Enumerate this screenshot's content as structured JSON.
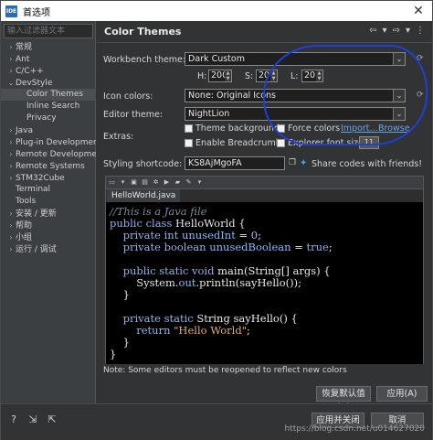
{
  "window": {
    "title": "首选项",
    "app_icon_text": "IDE",
    "close_label": "✕"
  },
  "filter": {
    "placeholder": "输入过滤器文本"
  },
  "tree": [
    {
      "label": "常规",
      "arrow": "›",
      "level": 0
    },
    {
      "label": "Ant",
      "arrow": "›",
      "level": 0
    },
    {
      "label": "C/C++",
      "arrow": "›",
      "level": 0
    },
    {
      "label": "DevStyle",
      "arrow": "⌄",
      "level": 0
    },
    {
      "label": "Color Themes",
      "arrow": "",
      "level": 1,
      "selected": true
    },
    {
      "label": "Inline Search",
      "arrow": "",
      "level": 1
    },
    {
      "label": "Privacy",
      "arrow": "",
      "level": 1
    },
    {
      "label": "Java",
      "arrow": "›",
      "level": 0
    },
    {
      "label": "Plug-in Development",
      "arrow": "›",
      "level": 0
    },
    {
      "label": "Remote Development",
      "arrow": "›",
      "level": 0
    },
    {
      "label": "Remote Systems",
      "arrow": "›",
      "level": 0
    },
    {
      "label": "STM32Cube",
      "arrow": "›",
      "level": 0
    },
    {
      "label": "Terminal",
      "arrow": "",
      "level": 0
    },
    {
      "label": "Tools",
      "arrow": "",
      "level": 0
    },
    {
      "label": "安装 / 更新",
      "arrow": "›",
      "level": 0
    },
    {
      "label": "帮助",
      "arrow": "›",
      "level": 0
    },
    {
      "label": "小组",
      "arrow": "›",
      "level": 0
    },
    {
      "label": "运行 / 调试",
      "arrow": "›",
      "level": 0
    }
  ],
  "header": {
    "title": "Color Themes"
  },
  "form": {
    "workbench_theme_label": "Workbench theme:",
    "workbench_theme_value": "Dark Custom",
    "h_label": "H:",
    "h_value": "200",
    "s_label": "S:",
    "s_value": "20",
    "l_label": "L:",
    "l_value": "20",
    "icon_colors_label": "Icon colors:",
    "icon_colors_value": "None: Original Icons",
    "editor_theme_label": "Editor theme:",
    "editor_theme_value": "NightLion",
    "extras_label": "Extras:",
    "theme_background": "Theme background",
    "force_colors": "Force colors",
    "import_link": "Import...",
    "browse_link": "Browse",
    "enable_breadcrumb": "Enable Breadcrumb",
    "explorer_font_size": "Explorer font size",
    "font_size_value": "11",
    "shortcode_label": "Styling shortcode:",
    "shortcode_value": "KS8AjMgoFA",
    "share_text": "Share codes with friends!"
  },
  "preview": {
    "tab": "HelloWorld.java",
    "lines": [
      [
        {
          "t": "//This is a Java file",
          "c": "com"
        }
      ],
      [
        {
          "t": "public class ",
          "c": "kw"
        },
        {
          "t": "HelloWorld {",
          "c": "tx"
        }
      ],
      [
        {
          "t": "    private int ",
          "c": "kw"
        },
        {
          "t": "unusedInt",
          "c": "fld"
        },
        {
          "t": " = ",
          "c": "tx"
        },
        {
          "t": "0",
          "c": "num"
        },
        {
          "t": ";",
          "c": "tx"
        }
      ],
      [
        {
          "t": "    private boolean ",
          "c": "kw"
        },
        {
          "t": "unusedBoolean",
          "c": "fld"
        },
        {
          "t": " = ",
          "c": "tx"
        },
        {
          "t": "true",
          "c": "kw"
        },
        {
          "t": ";",
          "c": "tx"
        }
      ],
      [
        {
          "t": "",
          "c": "tx"
        }
      ],
      [
        {
          "t": "    public static void ",
          "c": "kw"
        },
        {
          "t": "main(String[] args) {",
          "c": "tx"
        }
      ],
      [
        {
          "t": "        System.",
          "c": "tx"
        },
        {
          "t": "out",
          "c": "fld"
        },
        {
          "t": ".println(sayHello());",
          "c": "tx"
        }
      ],
      [
        {
          "t": "    }",
          "c": "tx"
        }
      ],
      [
        {
          "t": "",
          "c": "tx"
        }
      ],
      [
        {
          "t": "    private static ",
          "c": "kw"
        },
        {
          "t": "String sayHello() {",
          "c": "tx"
        }
      ],
      [
        {
          "t": "        return ",
          "c": "kw"
        },
        {
          "t": "\"Hello World\"",
          "c": "str"
        },
        {
          "t": ";",
          "c": "tx"
        }
      ],
      [
        {
          "t": "    }",
          "c": "tx"
        }
      ],
      [
        {
          "t": "}",
          "c": "tx"
        }
      ]
    ]
  },
  "note": "Note: Some editors must be reopened to reflect new colors",
  "buttons": {
    "restore_defaults": "恢复默认值(D)",
    "apply": "应用(A)",
    "apply_close": "应用并关闭",
    "cancel": "取消"
  },
  "watermark": "https://blog.csdn.net/u014627020",
  "colors": {
    "annotation": "#1f3fd6",
    "link": "#6ba4e7",
    "editor_bg": "#000000"
  }
}
